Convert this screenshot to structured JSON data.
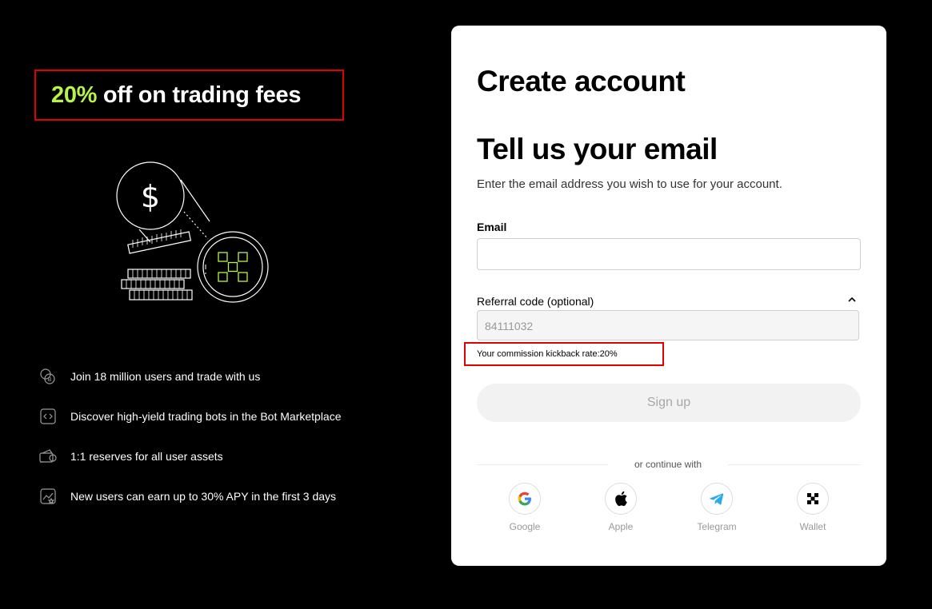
{
  "promo": {
    "highlight": "20%",
    "rest": " off on trading fees"
  },
  "features": [
    {
      "icon": "users-coin-icon",
      "text": "Join 18 million users and trade with us"
    },
    {
      "icon": "code-file-icon",
      "text": "Discover high-yield trading bots in the Bot Marketplace"
    },
    {
      "icon": "wallet-reserves-icon",
      "text": "1:1 reserves for all user assets"
    },
    {
      "icon": "chart-star-icon",
      "text": "New users can earn up to 30% APY in the first 3 days"
    }
  ],
  "card": {
    "title": "Create account",
    "heading": "Tell us your email",
    "subtitle": "Enter the email address you wish to use for your account.",
    "email_label": "Email",
    "email_value": "",
    "referral_label": "Referral code (optional)",
    "referral_value": "84111032",
    "kickback_text": "Your commission kickback rate:20%",
    "signup_label": "Sign up",
    "or_text": "or continue with",
    "social": [
      {
        "icon": "google-icon",
        "label": "Google"
      },
      {
        "icon": "apple-icon",
        "label": "Apple"
      },
      {
        "icon": "telegram-icon",
        "label": "Telegram"
      },
      {
        "icon": "wallet-icon",
        "label": "Wallet"
      }
    ]
  },
  "colors": {
    "accent": "#b8f34a",
    "highlight_border": "#e00000",
    "background": "#000000",
    "card": "#ffffff"
  }
}
